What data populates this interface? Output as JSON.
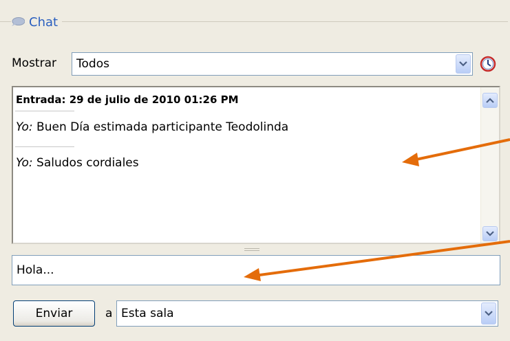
{
  "panel": {
    "title": "Chat",
    "icon": "chat-bubble-icon"
  },
  "filter": {
    "label": "Mostrar",
    "selected": "Todos",
    "history_icon": "clock-icon"
  },
  "log": {
    "entry_header": "Entrada: 29 de julio de 2010 01:26 PM",
    "messages": [
      {
        "sender": "Yo:",
        "text": " Buen Día estimada participante Teodolinda"
      },
      {
        "sender": "Yo:",
        "text": " Saludos cordiales"
      }
    ]
  },
  "compose": {
    "value": "Hola..."
  },
  "send": {
    "button_label": "Enviar",
    "to_label": "a",
    "recipient": "Esta sala"
  },
  "colors": {
    "accent": "#2a5fbf",
    "annotation_arrow": "#e46c0a",
    "border": "#7f9db9"
  }
}
